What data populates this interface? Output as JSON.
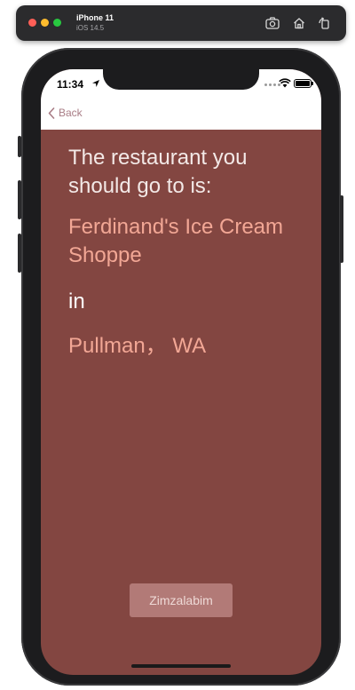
{
  "simulator": {
    "device_name": "iPhone 11",
    "os_version": "iOS 14.5",
    "icons": [
      "screenshot-icon",
      "home-icon",
      "rotate-icon"
    ]
  },
  "status_bar": {
    "time": "11:34"
  },
  "nav": {
    "back_label": "Back"
  },
  "content": {
    "headline": "The restaurant you should go to is:",
    "restaurant_name": "Ferdinand's Ice Cream Shoppe",
    "connector": "in",
    "location": "Pullman， WA"
  },
  "action": {
    "label": "Zimzalabim"
  },
  "colors": {
    "background": "#834641",
    "accent_text": "#f2a795",
    "button_bg": "#b27a77",
    "back_tint": "#a97d86"
  }
}
